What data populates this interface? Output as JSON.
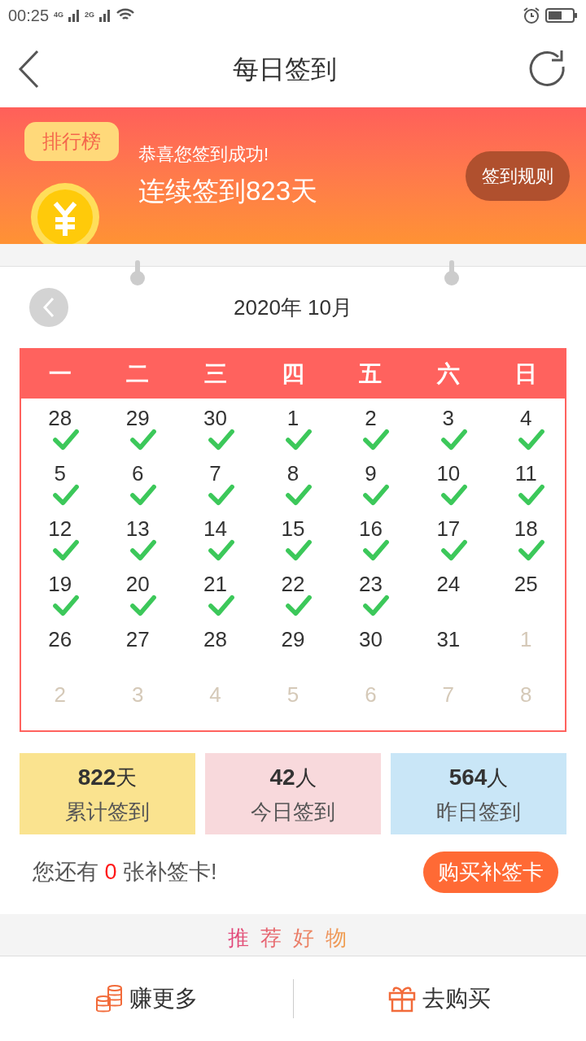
{
  "status_bar": {
    "time": "00:25",
    "network_1": "4G",
    "network_2": "2G"
  },
  "nav": {
    "title": "每日签到"
  },
  "banner": {
    "ranking_label": "排行榜",
    "message": "恭喜您签到成功!",
    "streak": "连续签到823天",
    "rules_button": "签到规则"
  },
  "calendar": {
    "month": "2020年 10月",
    "weekdays": [
      "一",
      "二",
      "三",
      "四",
      "五",
      "六",
      "日"
    ],
    "days": [
      {
        "label": "28",
        "checked": true,
        "outside": false
      },
      {
        "label": "29",
        "checked": true,
        "outside": false
      },
      {
        "label": "30",
        "checked": true,
        "outside": false
      },
      {
        "label": "1",
        "checked": true,
        "outside": false
      },
      {
        "label": "2",
        "checked": true,
        "outside": false
      },
      {
        "label": "3",
        "checked": true,
        "outside": false
      },
      {
        "label": "4",
        "checked": true,
        "outside": false
      },
      {
        "label": "5",
        "checked": true,
        "outside": false
      },
      {
        "label": "6",
        "checked": true,
        "outside": false
      },
      {
        "label": "7",
        "checked": true,
        "outside": false
      },
      {
        "label": "8",
        "checked": true,
        "outside": false
      },
      {
        "label": "9",
        "checked": true,
        "outside": false
      },
      {
        "label": "10",
        "checked": true,
        "outside": false
      },
      {
        "label": "11",
        "checked": true,
        "outside": false
      },
      {
        "label": "12",
        "checked": true,
        "outside": false
      },
      {
        "label": "13",
        "checked": true,
        "outside": false
      },
      {
        "label": "14",
        "checked": true,
        "outside": false
      },
      {
        "label": "15",
        "checked": true,
        "outside": false
      },
      {
        "label": "16",
        "checked": true,
        "outside": false
      },
      {
        "label": "17",
        "checked": true,
        "outside": false
      },
      {
        "label": "18",
        "checked": true,
        "outside": false
      },
      {
        "label": "19",
        "checked": true,
        "outside": false
      },
      {
        "label": "20",
        "checked": true,
        "outside": false
      },
      {
        "label": "21",
        "checked": true,
        "outside": false
      },
      {
        "label": "22",
        "checked": true,
        "outside": false
      },
      {
        "label": "23",
        "checked": true,
        "outside": false
      },
      {
        "label": "24",
        "checked": false,
        "outside": false
      },
      {
        "label": "25",
        "checked": false,
        "outside": false
      },
      {
        "label": "26",
        "checked": false,
        "outside": false
      },
      {
        "label": "27",
        "checked": false,
        "outside": false
      },
      {
        "label": "28",
        "checked": false,
        "outside": false
      },
      {
        "label": "29",
        "checked": false,
        "outside": false
      },
      {
        "label": "30",
        "checked": false,
        "outside": false
      },
      {
        "label": "31",
        "checked": false,
        "outside": false
      },
      {
        "label": "1",
        "checked": false,
        "outside": true
      },
      {
        "label": "2",
        "checked": false,
        "outside": true
      },
      {
        "label": "3",
        "checked": false,
        "outside": true
      },
      {
        "label": "4",
        "checked": false,
        "outside": true
      },
      {
        "label": "5",
        "checked": false,
        "outside": true
      },
      {
        "label": "6",
        "checked": false,
        "outside": true
      },
      {
        "label": "7",
        "checked": false,
        "outside": true
      },
      {
        "label": "8",
        "checked": false,
        "outside": true
      }
    ]
  },
  "stats": [
    {
      "value": "822",
      "unit": "天",
      "label": "累计签到",
      "color": "#fae38f"
    },
    {
      "value": "42",
      "unit": "人",
      "label": "今日签到",
      "color": "#f8d9dc"
    },
    {
      "value": "564",
      "unit": "人",
      "label": "昨日签到",
      "color": "#c9e6f7"
    }
  ],
  "makeup": {
    "before": "您还有",
    "count": "0",
    "after": "张补签卡!",
    "button": "购买补签卡"
  },
  "recommend": {
    "heading": [
      "推",
      "荐",
      "好",
      "物"
    ]
  },
  "bottom_bar": [
    {
      "kind": "coins",
      "label": "赚更多"
    },
    {
      "kind": "gift",
      "label": "去购买"
    }
  ]
}
